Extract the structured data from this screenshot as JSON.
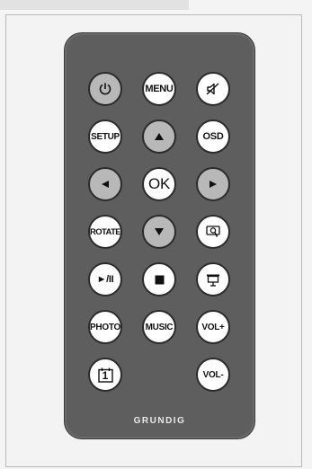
{
  "buttons": {
    "power": {
      "icon": "power-icon"
    },
    "menu": {
      "label": "MENU"
    },
    "mute": {
      "icon": "mute-speaker-icon"
    },
    "setup": {
      "label": "SETUP"
    },
    "up": {
      "icon": "arrow-up-icon"
    },
    "osd": {
      "label": "OSD"
    },
    "left": {
      "icon": "arrow-left-icon"
    },
    "ok": {
      "label": "OK"
    },
    "right": {
      "icon": "arrow-right-icon"
    },
    "rotate": {
      "label": "ROTATE"
    },
    "down": {
      "icon": "arrow-down-icon"
    },
    "zoom": {
      "icon": "zoom-magnifier-icon"
    },
    "play_pause": {
      "label": "►/II"
    },
    "stop": {
      "icon": "stop-icon"
    },
    "slideshow": {
      "icon": "slideshow-screen-icon"
    },
    "photo": {
      "label": "PHOTO"
    },
    "music": {
      "label": "MUSIC"
    },
    "vol_up": {
      "label": "VOL+"
    },
    "calendar": {
      "icon": "calendar-icon",
      "text": "1"
    },
    "vol_down": {
      "label": "VOL-"
    }
  },
  "brand": "GRUNDIG",
  "colors": {
    "remote_body": "#5e5e5e",
    "button_grey": "#b8b8b8",
    "button_white": "#ffffff",
    "background": "#f4f4f4"
  }
}
